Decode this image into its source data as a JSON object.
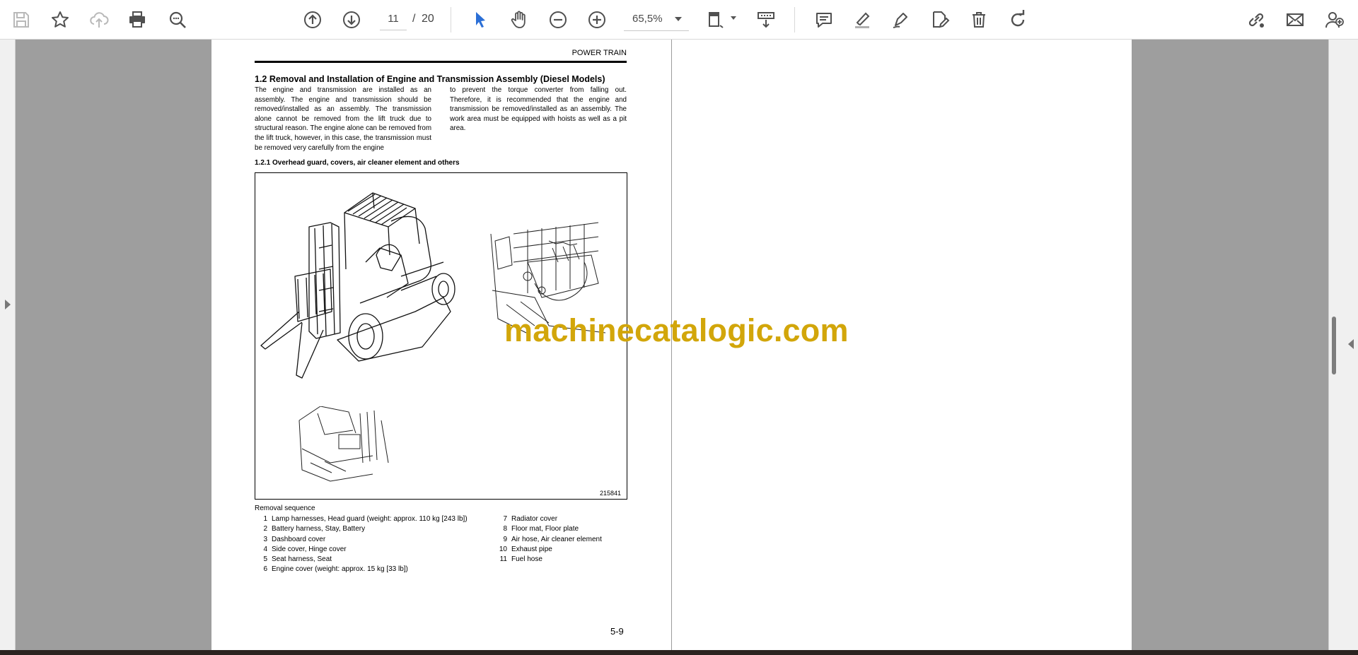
{
  "toolbar": {
    "page_current": "11",
    "page_separator": "/",
    "page_total": "20",
    "zoom": "65,5%",
    "icons": [
      "save-icon",
      "bookmark-star-icon",
      "cloud-upload-icon",
      "print-icon",
      "zoom-search-icon",
      "page-up-icon",
      "page-down-icon",
      "select-cursor-icon",
      "hand-icon",
      "zoom-out-icon",
      "zoom-in-icon",
      "page-fit-icon",
      "scroll-mode-icon",
      "comment-icon",
      "highlight-icon",
      "draw-icon",
      "edit-icon",
      "delete-icon",
      "rotate-icon",
      "share-link-icon",
      "email-icon",
      "account-icon"
    ],
    "colors": {
      "accent": "#2b6fd6",
      "icon": "#505050"
    }
  },
  "document": {
    "header": "POWER TRAIN",
    "section_title": "1.2   Removal and Installation of Engine and Transmission Assembly (Diesel Models)",
    "col1": "The engine and transmission are installed as an assembly. The engine and transmission should be removed/installed as an assembly. The transmission alone cannot be removed from the lift truck due to structural reason. The engine alone can be removed from the lift truck, however, in this case, the transmission must be removed very carefully from the engine",
    "col2": "to prevent the torque converter from falling out. Therefore, it is recommended that the engine and transmission be removed/installed as an assembly. The work area must be equipped with hoists as well as a pit area.",
    "subsection_title": "1.2.1   Overhead guard, covers, air cleaner element and others",
    "figure_number": "215841",
    "removal_label": "Removal sequence",
    "removal_list_left": [
      {
        "num": "1",
        "text": "Lamp harnesses, Head guard (weight: approx. 110 kg [243 lb])"
      },
      {
        "num": "2",
        "text": "Battery harness, Stay, Battery"
      },
      {
        "num": "3",
        "text": "Dashboard cover"
      },
      {
        "num": "4",
        "text": "Side cover, Hinge cover"
      },
      {
        "num": "5",
        "text": "Seat harness, Seat"
      },
      {
        "num": "6",
        "text": "Engine cover (weight: approx. 15 kg [33 lb])"
      }
    ],
    "removal_list_right": [
      {
        "num": "7",
        "text": "Radiator cover"
      },
      {
        "num": "8",
        "text": "Floor mat, Floor plate"
      },
      {
        "num": "9",
        "text": "Air hose, Air cleaner element"
      },
      {
        "num": "10",
        "text": "Exhaust pipe"
      },
      {
        "num": "11",
        "text": "Fuel hose"
      }
    ],
    "page_footer": "5-9"
  },
  "watermark": "machinecatalogic.com"
}
